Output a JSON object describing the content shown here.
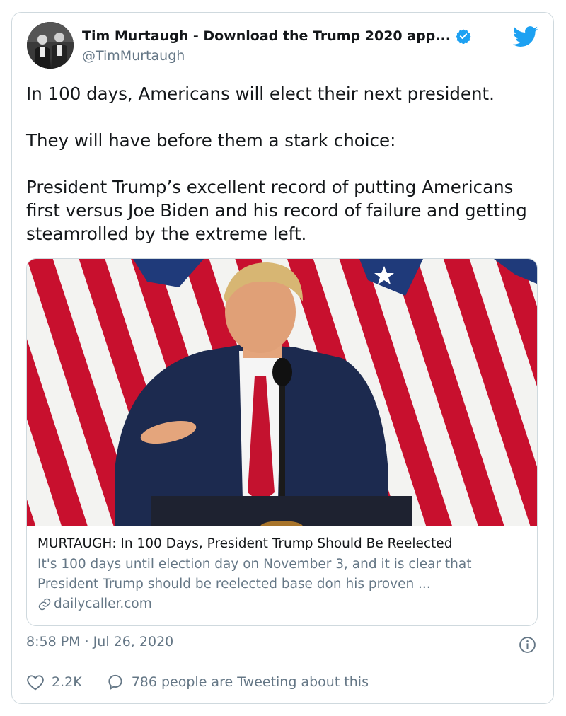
{
  "author": {
    "display_name": "Tim Murtaugh - Download the Trump 2020 app...",
    "handle": "@TimMurtaugh",
    "verified": true
  },
  "tweet": {
    "paragraphs": [
      "In 100 days, Americans will elect their next president.",
      "They will have before them a stark choice:",
      "President Trump’s excellent record of putting Americans first versus Joe Biden and his record of failure and getting steamrolled by the extreme left."
    ],
    "timestamp": "8:58 PM · Jul 26, 2020"
  },
  "card": {
    "title": "MURTAUGH: In 100 Days, President Trump Should Be Reelected",
    "description": "It's 100 days until election day on November 3, and it is clear that President Trump should be reelected base don his proven ...",
    "domain": "dailycaller.com",
    "image_icon": "flag-backdrop-podium-photo"
  },
  "engagement": {
    "likes": "2.2K",
    "conversation": "786 people are Tweeting about this"
  },
  "icons": {
    "verified": "verified-badge-icon",
    "brand": "twitter-bird-icon",
    "info": "info-icon",
    "like": "heart-icon",
    "reply": "speech-bubble-icon",
    "link": "link-icon"
  },
  "colors": {
    "twitter_blue": "#1da1f2",
    "secondary_text": "#657786",
    "primary_text": "#14171a",
    "border": "#cfd9de"
  }
}
